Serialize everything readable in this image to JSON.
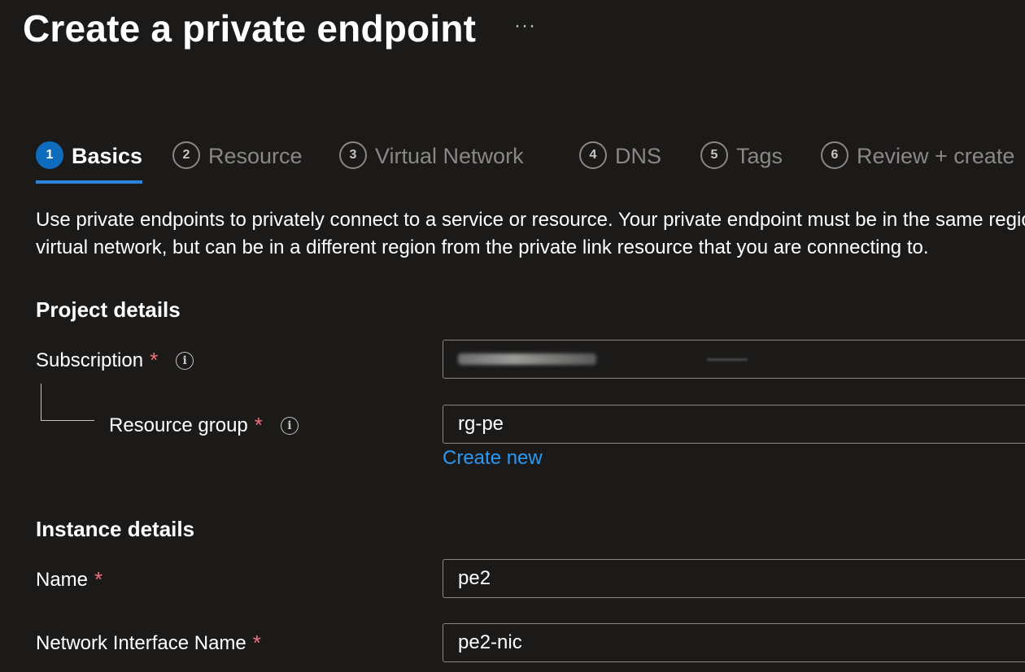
{
  "page": {
    "title": "Create a private endpoint",
    "more_label": "···"
  },
  "tabs": [
    {
      "number": "1",
      "label": "Basics",
      "active": true
    },
    {
      "number": "2",
      "label": "Resource",
      "active": false
    },
    {
      "number": "3",
      "label": "Virtual Network",
      "active": false
    },
    {
      "number": "4",
      "label": "DNS",
      "active": false
    },
    {
      "number": "5",
      "label": "Tags",
      "active": false
    },
    {
      "number": "6",
      "label": "Review + create",
      "active": false
    }
  ],
  "description": {
    "line1": "Use private endpoints to privately connect to a service or resource. Your private endpoint must be in the same region as your",
    "line2": "virtual network, but can be in a different region from the private link resource that you are connecting to."
  },
  "project_details": {
    "heading": "Project details",
    "subscription_label": "Subscription",
    "resource_group_label": "Resource group",
    "resource_group_value": "rg-pe",
    "create_new_label": "Create new"
  },
  "instance_details": {
    "heading": "Instance details",
    "name_label": "Name",
    "name_value": "pe2",
    "nic_label": "Network Interface Name",
    "nic_value": "pe2-nic"
  },
  "required_marker": "*",
  "info_glyph": "i",
  "colors": {
    "background": "#1b1a19",
    "accent": "#0f6cbd",
    "link": "#2899f5",
    "required": "#f1707b"
  }
}
